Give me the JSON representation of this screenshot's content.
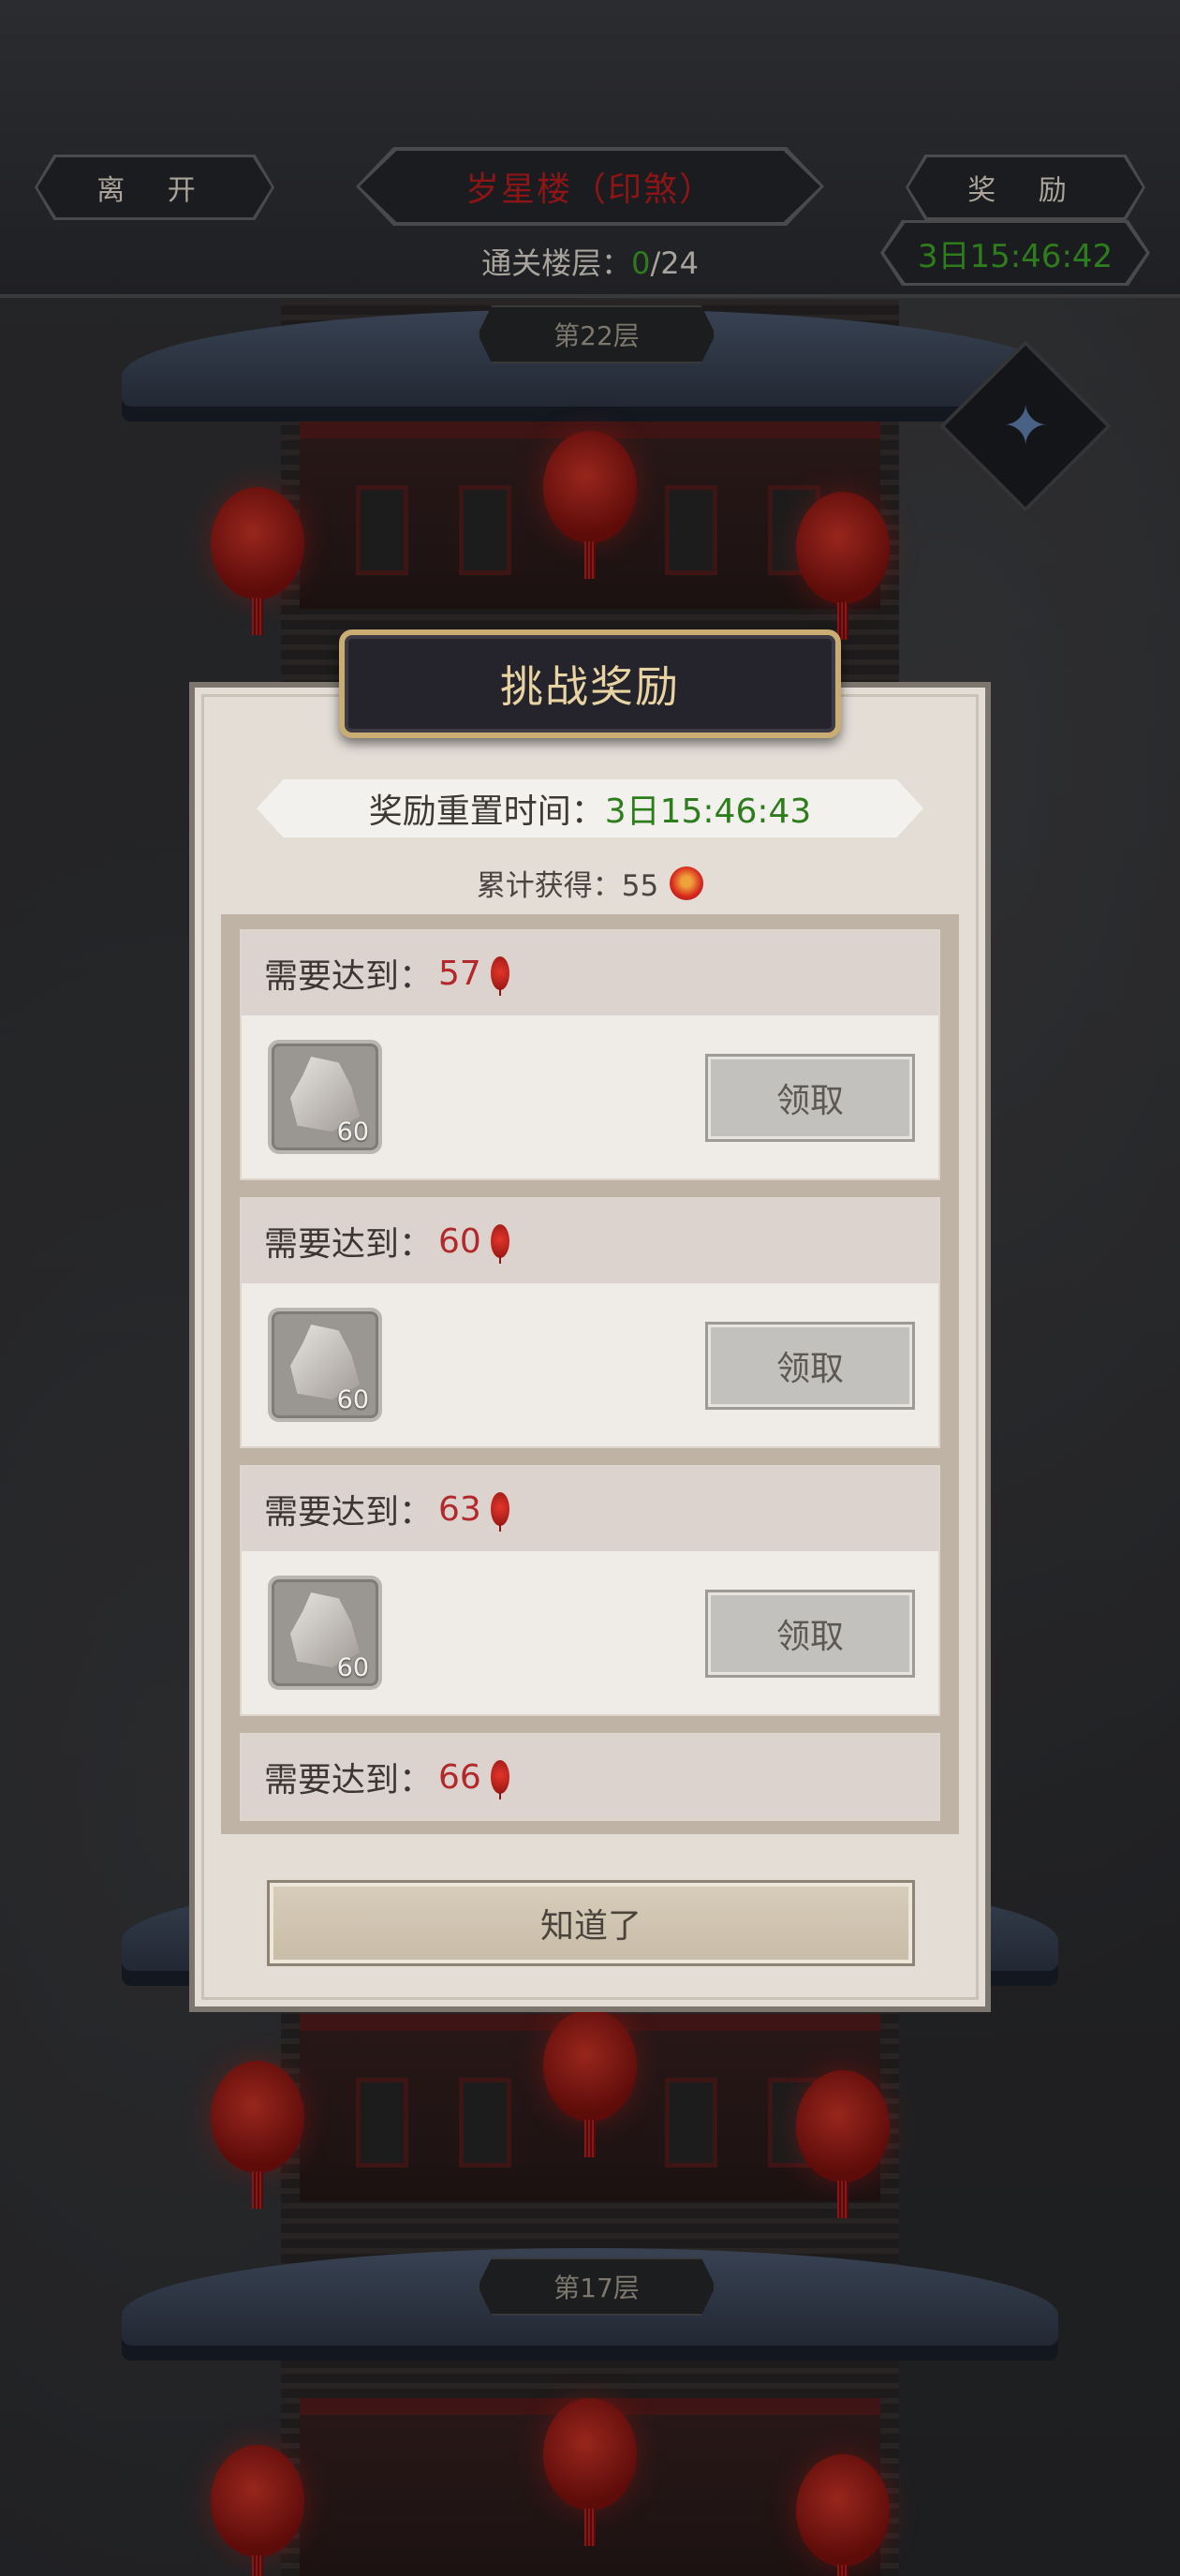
{
  "header": {
    "leave_label": "离 开",
    "tower_title": "岁星楼（印煞）",
    "rewards_label": "奖 励",
    "floors_label": "通关楼层：",
    "floors_current": "0",
    "floors_total": "/24",
    "timer": "3日15:46:42"
  },
  "scene": {
    "floor_upper": "第22层",
    "floor_lower": "第17层"
  },
  "dialog": {
    "title": "挑战奖励",
    "reset_label": "奖励重置时间：",
    "reset_time": "3日15:46:43",
    "total_label": "累计获得：55",
    "rewards": [
      {
        "req_label": "需要达到：",
        "req_value": "57",
        "item_count": "60",
        "claim_label": "领取"
      },
      {
        "req_label": "需要达到：",
        "req_value": "60",
        "item_count": "60",
        "claim_label": "领取"
      },
      {
        "req_label": "需要达到：",
        "req_value": "63",
        "item_count": "60",
        "claim_label": "领取"
      },
      {
        "req_label": "需要达到：",
        "req_value": "66"
      }
    ],
    "ok_label": "知道了"
  },
  "icons": {
    "lantern": "lantern-icon",
    "item": "stone-fragment-icon",
    "badge": "gauntlet-icon"
  }
}
